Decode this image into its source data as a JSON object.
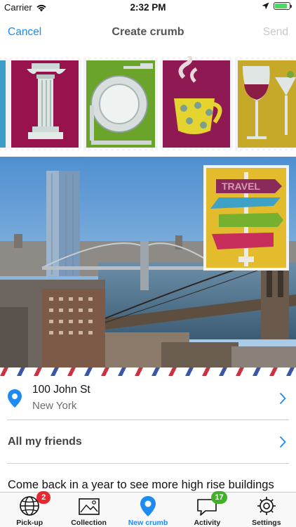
{
  "status_bar": {
    "carrier": "Carrier",
    "time": "2:32 PM",
    "battery_level": 0.85,
    "battery_color": "#4cd964"
  },
  "nav": {
    "cancel": "Cancel",
    "title": "Create crumb",
    "send": "Send",
    "accent": "#1d8bf2"
  },
  "stamps": {
    "items": [
      "column-stamp",
      "plate-stamp",
      "cup-stamp",
      "wine-stamp"
    ],
    "overlay_stamp": {
      "icon": "signpost-stamp",
      "text": "TRAVEL"
    }
  },
  "location": {
    "street": "100 John St",
    "city": "New York",
    "icon": "location-pin-icon"
  },
  "audience": {
    "label": "All my friends"
  },
  "message": "Come back in a year to see more high rise buildings",
  "tabs": [
    {
      "label": "Pick-up",
      "icon": "globe-icon",
      "badge": "2",
      "badge_color": "#e8272f"
    },
    {
      "label": "Collection",
      "icon": "photo-icon",
      "badge": null
    },
    {
      "label": "New crumb",
      "icon": "pin-icon",
      "badge": null,
      "active": true
    },
    {
      "label": "Activity",
      "icon": "chat-bubble-icon",
      "badge": "17",
      "badge_color": "#43b02a"
    },
    {
      "label": "Settings",
      "icon": "gear-icon",
      "badge": null
    }
  ]
}
